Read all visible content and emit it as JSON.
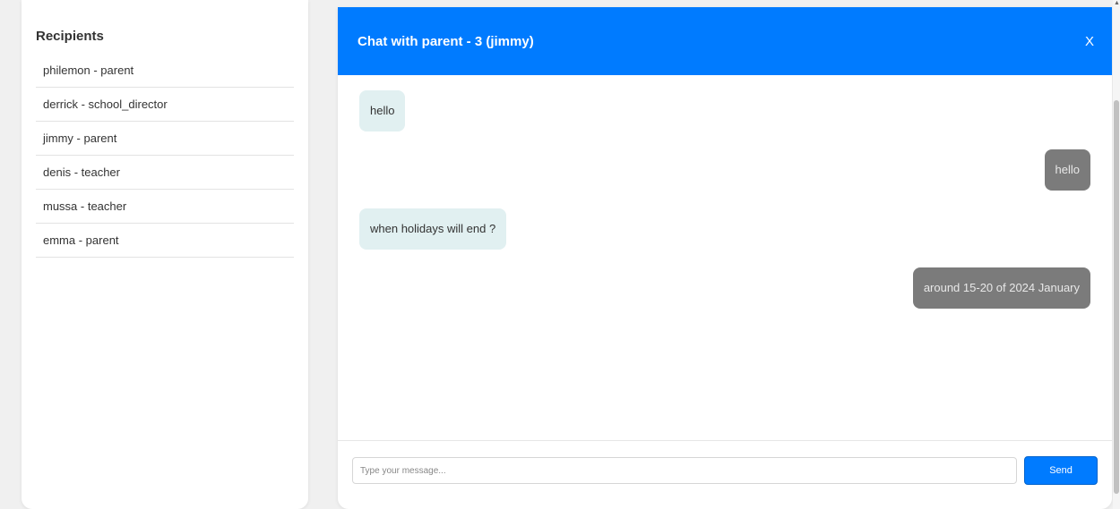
{
  "recipients": {
    "title": "Recipients",
    "items": [
      {
        "label": "philemon - parent"
      },
      {
        "label": "derrick - school_director"
      },
      {
        "label": "jimmy - parent"
      },
      {
        "label": "denis - teacher"
      },
      {
        "label": "mussa - teacher"
      },
      {
        "label": "emma - parent"
      }
    ]
  },
  "chat": {
    "title": "Chat with parent - 3 (jimmy)",
    "close_label": "X",
    "messages": [
      {
        "text": "hello",
        "direction": "incoming"
      },
      {
        "text": "hello",
        "direction": "outgoing"
      },
      {
        "text": "when holidays will end ?",
        "direction": "incoming"
      },
      {
        "text": "around 15-20 of 2024 January",
        "direction": "outgoing"
      }
    ],
    "input": {
      "placeholder": "Type your message...",
      "value": ""
    },
    "send_label": "Send"
  },
  "colors": {
    "accent": "#007bff",
    "incoming_bubble": "#e1f0f1",
    "outgoing_bubble": "#7b7b7b"
  },
  "icons": {
    "scroll_up": "▲"
  }
}
